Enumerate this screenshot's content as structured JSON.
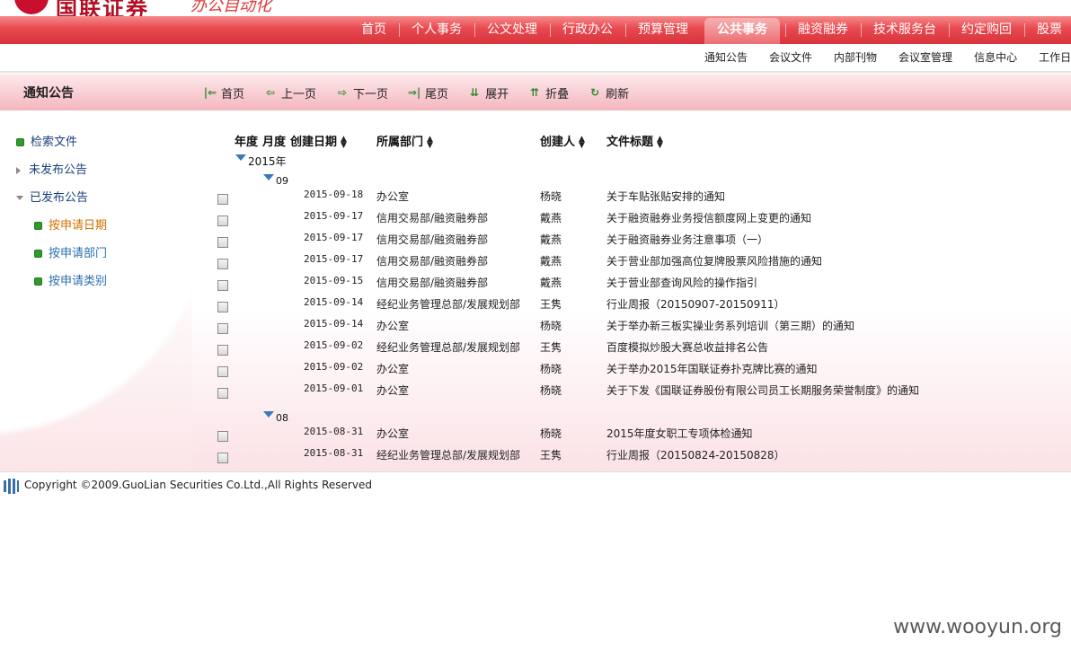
{
  "header": {
    "logo_text": "国联证券",
    "slogan": "办公自动化"
  },
  "mainnav": [
    {
      "label": "首页",
      "active": false
    },
    {
      "label": "个人事务",
      "active": false
    },
    {
      "label": "公文处理",
      "active": false
    },
    {
      "label": "行政办公",
      "active": false
    },
    {
      "label": "预算管理",
      "active": false
    },
    {
      "label": "公共事务",
      "active": true
    },
    {
      "label": "融资融券",
      "active": false
    },
    {
      "label": "技术服务台",
      "active": false
    },
    {
      "label": "约定购回",
      "active": false
    },
    {
      "label": "股票",
      "active": false
    }
  ],
  "subnav": [
    "通知公告",
    "会议文件",
    "内部刊物",
    "会议室管理",
    "信息中心",
    "工作日"
  ],
  "toolbar": {
    "section_title": "通知公告",
    "tools": [
      {
        "label": "首页",
        "icon": "first-page-icon"
      },
      {
        "label": "上一页",
        "icon": "prev-page-icon"
      },
      {
        "label": "下一页",
        "icon": "next-page-icon"
      },
      {
        "label": "尾页",
        "icon": "last-page-icon"
      },
      {
        "label": "展开",
        "icon": "expand-icon"
      },
      {
        "label": "折叠",
        "icon": "collapse-icon"
      },
      {
        "label": "刷新",
        "icon": "refresh-icon"
      }
    ]
  },
  "sidebar": {
    "items": [
      {
        "label": "检索文件",
        "level": 1,
        "marker": "bullet"
      },
      {
        "label": "未发布公告",
        "level": 1,
        "marker": "collapsed"
      },
      {
        "label": "已发布公告",
        "level": 1,
        "marker": "expanded"
      },
      {
        "label": "按申请日期",
        "level": 2,
        "marker": "bullet",
        "selected": true
      },
      {
        "label": "按申请部门",
        "level": 2,
        "marker": "bullet"
      },
      {
        "label": "按申请类别",
        "level": 2,
        "marker": "bullet"
      }
    ]
  },
  "table": {
    "headers": {
      "year": "年度",
      "month": "月度",
      "date": "创建日期",
      "dept": "所属部门",
      "creator": "创建人",
      "title": "文件标题"
    },
    "year_group": "2015年",
    "month_groups": [
      {
        "label": "09",
        "rows": [
          {
            "date": "2015-09-18",
            "dept": "办公室",
            "creator": "杨晓",
            "title": "关于车贴张贴安排的通知"
          },
          {
            "date": "2015-09-17",
            "dept": "信用交易部/融资融券部",
            "creator": "戴燕",
            "title": "关于融资融券业务授信额度网上变更的通知"
          },
          {
            "date": "2015-09-17",
            "dept": "信用交易部/融资融券部",
            "creator": "戴燕",
            "title": "关于融资融券业务注意事项（一）"
          },
          {
            "date": "2015-09-17",
            "dept": "信用交易部/融资融券部",
            "creator": "戴燕",
            "title": "关于营业部加强高位复牌股票风险措施的通知"
          },
          {
            "date": "2015-09-15",
            "dept": "信用交易部/融资融券部",
            "creator": "戴燕",
            "title": "关于营业部查询风险的操作指引"
          },
          {
            "date": "2015-09-14",
            "dept": "经纪业务管理总部/发展规划部",
            "creator": "王隽",
            "title": "行业周报（20150907-20150911）"
          },
          {
            "date": "2015-09-14",
            "dept": "办公室",
            "creator": "杨晓",
            "title": "关于举办新三板实操业务系列培训（第三期）的通知"
          },
          {
            "date": "2015-09-02",
            "dept": "经纪业务管理总部/发展规划部",
            "creator": "王隽",
            "title": "百度模拟炒股大赛总收益排名公告"
          },
          {
            "date": "2015-09-02",
            "dept": "办公室",
            "creator": "杨晓",
            "title": "关于举办2015年国联证券扑克牌比赛的通知"
          },
          {
            "date": "2015-09-01",
            "dept": "办公室",
            "creator": "杨晓",
            "title": "关于下发《国联证券股份有限公司员工长期服务荣誉制度》的通知"
          }
        ]
      },
      {
        "label": "08",
        "rows": [
          {
            "date": "2015-08-31",
            "dept": "办公室",
            "creator": "杨晓",
            "title": "2015年度女职工专项体检通知"
          },
          {
            "date": "2015-08-31",
            "dept": "经纪业务管理总部/发展规划部",
            "creator": "王隽",
            "title": "行业周报（20150824-20150828）"
          }
        ]
      }
    ]
  },
  "footer": {
    "copyright": "Copyright ©2009.GuoLian Securities Co.Ltd.,All Rights Reserved"
  },
  "watermark": "www.wooyun.org",
  "colors": {
    "nav_red": "#e8484f",
    "bullet_green": "#2f9b2f",
    "selected_orange": "#d47000",
    "link_blue": "#2a6fb0"
  }
}
